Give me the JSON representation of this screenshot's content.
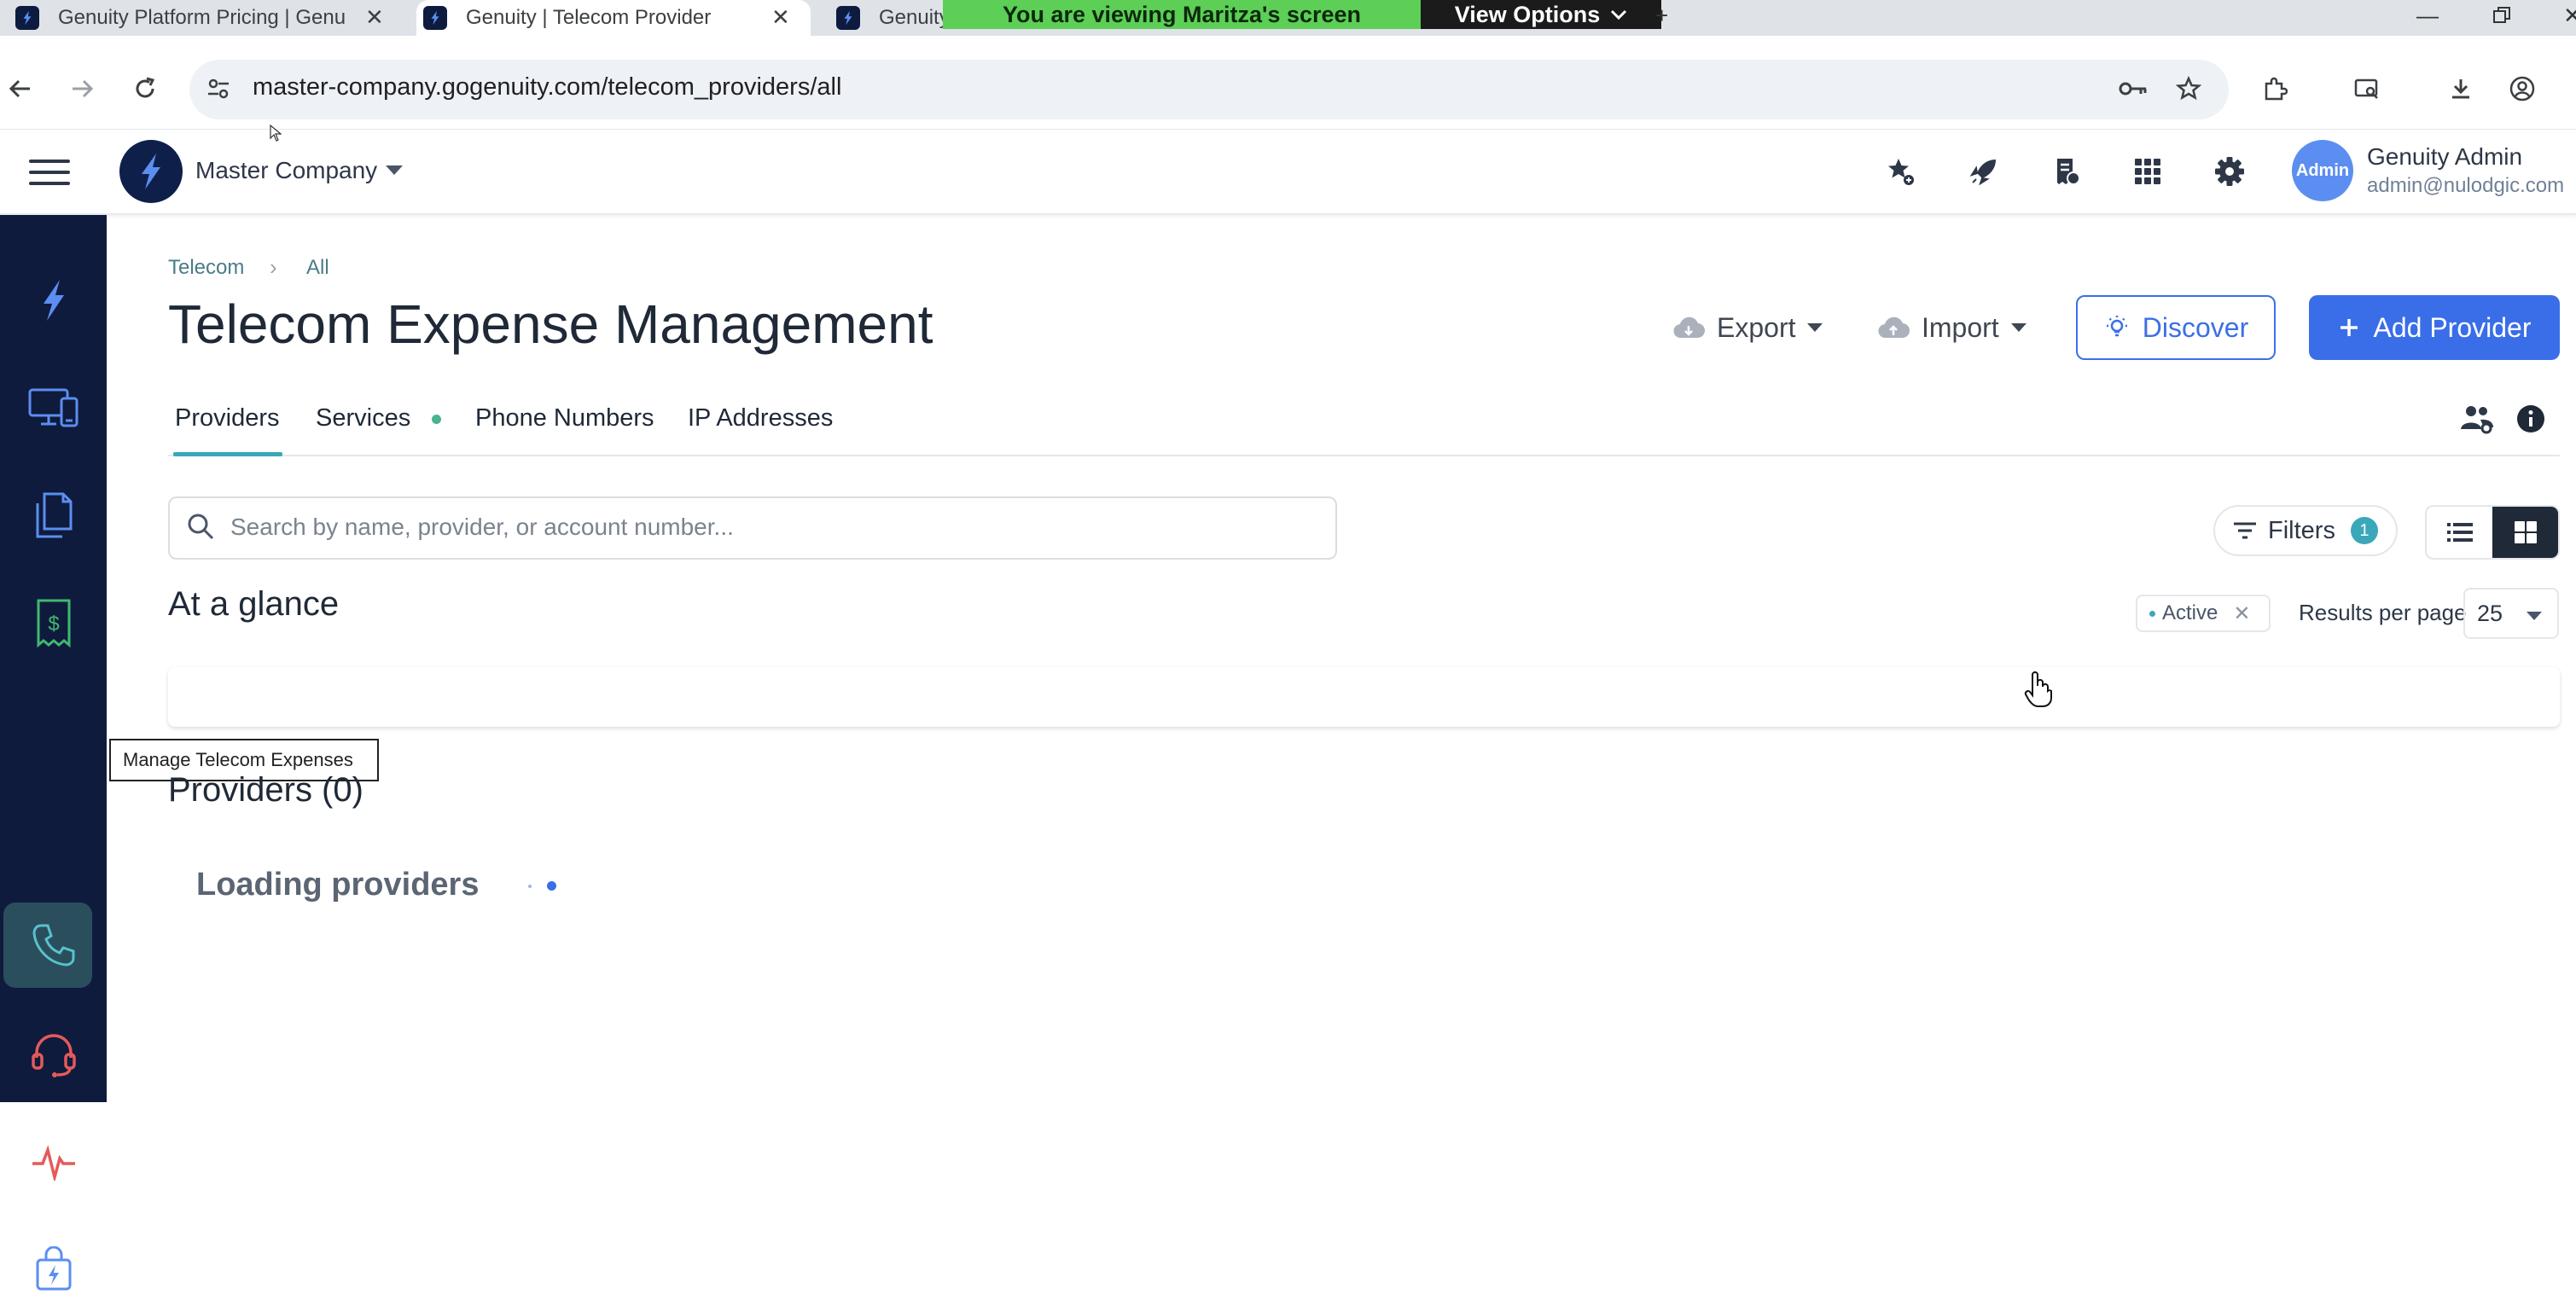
{
  "browser": {
    "tabs": [
      {
        "title": "Genuity Platform Pricing | Genu",
        "active": false
      },
      {
        "title": "Genuity | Telecom Provider",
        "active": true
      },
      {
        "title": "Genuity",
        "active": false
      }
    ],
    "share_banner": {
      "viewing_text": "You are viewing  Maritza's screen",
      "options_label": "View Options"
    },
    "url": "master-company.gogenuity.com/telecom_providers/all"
  },
  "header": {
    "company_name": "Master Company",
    "avatar_text": "Admin",
    "user_name": "Genuity Admin",
    "user_email": "admin@nulodgic.com",
    "icons": [
      "star-plus-icon",
      "rocket-icon",
      "receipt-icon",
      "apps-grid-icon",
      "settings-icon"
    ]
  },
  "sidebar": {
    "items": [
      {
        "name": "genuity-logo-icon",
        "active": false
      },
      {
        "name": "assets-icon",
        "active": false
      },
      {
        "name": "contracts-icon",
        "active": false
      },
      {
        "name": "vendors-icon",
        "active": false
      },
      {
        "name": "telecom-icon",
        "active": true
      },
      {
        "name": "helpdesk-icon",
        "active": false
      },
      {
        "name": "monitoring-icon",
        "active": false
      },
      {
        "name": "purchases-icon",
        "active": false
      }
    ],
    "tooltip": "Manage Telecom Expenses"
  },
  "breadcrumb": {
    "items": [
      "Telecom",
      "All"
    ]
  },
  "page": {
    "title": "Telecom Expense Management",
    "actions": {
      "export": "Export",
      "import": "Import",
      "discover": "Discover",
      "add": "Add Provider"
    }
  },
  "tabs": [
    {
      "label": "Providers",
      "active": true
    },
    {
      "label": "Services",
      "active": false
    },
    {
      "label": "Phone Numbers",
      "active": false
    },
    {
      "label": "IP Addresses",
      "active": false
    }
  ],
  "search": {
    "placeholder": "Search by name, provider, or account number..."
  },
  "filters": {
    "label": "Filters",
    "count": "1"
  },
  "at_a_glance": {
    "title": "At a glance"
  },
  "active_filter_chip": {
    "label": "Active"
  },
  "results_per_page": {
    "label": "Results per page",
    "value": "25"
  },
  "providers": {
    "title": "Providers (0)",
    "loading_text": "Loading providers"
  },
  "colors": {
    "primary": "#3a6ee8",
    "teal": "#3aa8b8",
    "sidebar": "#0f1b3d",
    "banner_green": "#5dcf57"
  }
}
